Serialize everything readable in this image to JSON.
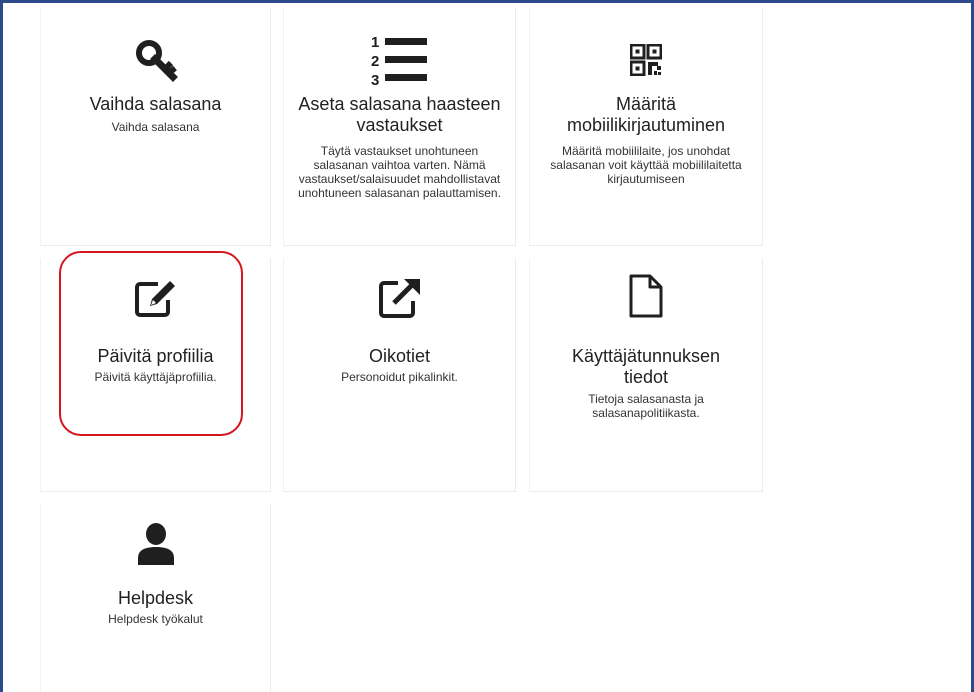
{
  "tiles": [
    {
      "title": "Vaihda salasana",
      "desc": "Vaihda salasana",
      "icon": "key-icon"
    },
    {
      "title": "Aseta salasana haasteen vastaukset",
      "desc": "Täytä vastaukset unohtuneen salasanan vaihtoa varten. Nämä vastaukset/salaisuudet mahdollistavat unohtuneen salasanan palauttamisen.",
      "icon": "numbered-list-icon"
    },
    {
      "title": "Määritä mobiilikirjautuminen",
      "desc": "Määritä mobiililaite, jos unohdat salasanan voit käyttää mobiililaitetta kirjautumiseen",
      "icon": "qr-code-icon"
    },
    {
      "title": "Päivitä profiilia",
      "desc": "Päivitä käyttäjäprofiilia.",
      "icon": "edit-icon"
    },
    {
      "title": "Oikotiet",
      "desc": "Personoidut pikalinkit.",
      "icon": "external-link-icon"
    },
    {
      "title": "Käyttäjätunnuksen tiedot",
      "desc": "Tietoja salasanasta ja salasanapolitiikasta.",
      "icon": "document-icon"
    },
    {
      "title": "Helpdesk",
      "desc": "Helpdesk työkalut",
      "icon": "user-icon"
    }
  ],
  "colors": {
    "frame": "#2f4a8a",
    "highlight": "#d4161e",
    "icon": "#1f1f1f"
  }
}
